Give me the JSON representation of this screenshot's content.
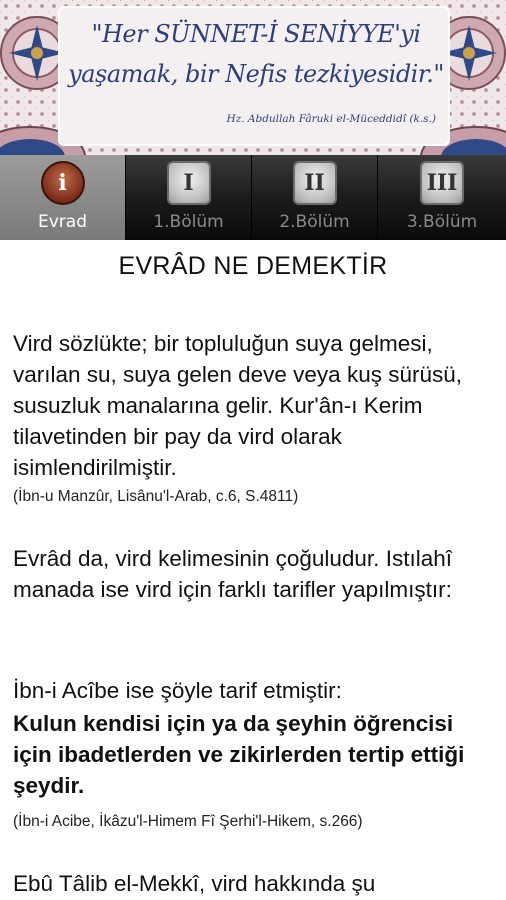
{
  "banner": {
    "quote_line1": "\"Her SÜNNET-İ SENİYYE'yi",
    "quote_line2": "yaşamak, bir Nefis tezkiyesidir.\"",
    "quote_source": "Hz. Abdullah Fâruki el-Müceddidî (k.s.)"
  },
  "tabs": [
    {
      "icon": "info-icon",
      "glyph": "i",
      "label": "Evrad",
      "active": true
    },
    {
      "icon": "roman-numeral-1-icon",
      "glyph": "I",
      "label": "1.Bölüm",
      "active": false
    },
    {
      "icon": "roman-numeral-2-icon",
      "glyph": "II",
      "label": "2.Bölüm",
      "active": false
    },
    {
      "icon": "roman-numeral-3-icon",
      "glyph": "III",
      "label": "3.Bölüm",
      "active": false
    }
  ],
  "content": {
    "title": "EVRÂD NE DEMEKTİR",
    "p1": "Vird sözlükte; bir topluluğun suya gelmesi, varılan su, suya gelen deve veya kuş sürüsü, susuzluk manalarına gelir. Kur'ân-ı Kerim tilavetinden bir pay da vird olarak isimlendirilmiştir.",
    "cite1": "(İbn-u Manzûr, Lisânu'l-Arab, c.6, S.4811)",
    "p2": "Evrâd da, vird kelimesinin çoğuludur. Istılahî manada ise vird için farklı tarifler yapılmıştır:",
    "p3": "İbn-i Acîbe ise şöyle tarif etmiştir:",
    "p4_bold": "Kulun kendisi için ya da şeyhin öğrencisi için ibadetlerden ve zikirlerden tertip ettiği şeydir.",
    "cite2": "(İbn-i Acibe, İkâzu'l-Himem Fî Şerhi'l-Hikem, s.266)",
    "p5": "Ebû Tâlib el-Mekkî, vird hakkında şu"
  },
  "colors": {
    "banner_text": "#2c3f7a",
    "tab_bar": "#1c1c1c",
    "tab_active": "#8a8a8a"
  }
}
